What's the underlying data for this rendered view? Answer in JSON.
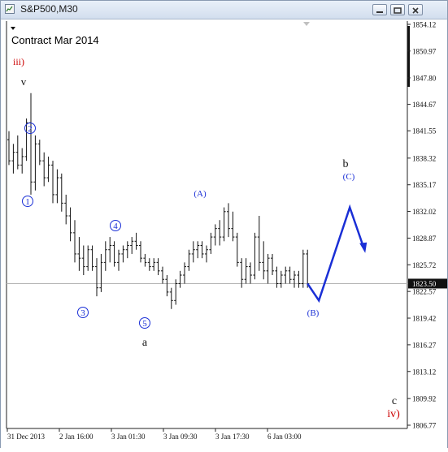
{
  "window": {
    "title": "S&P500,M30"
  },
  "contract_label": "Contract Mar 2014",
  "colors": {
    "bar": "#111111",
    "wave_blue": "#1a2fd6",
    "wave_red": "#cc0000",
    "wave_black": "#111111",
    "price_line": "#b5b5b5",
    "price_tag_bg": "#111111"
  },
  "chart_data": {
    "type": "ohlc",
    "price_axis_ticks": [
      "1854.12",
      "1850.97",
      "1847.80",
      "1844.67",
      "1841.55",
      "1838.32",
      "1835.17",
      "1832.02",
      "1828.87",
      "1825.72",
      "1822.57",
      "1819.42",
      "1816.27",
      "1813.12",
      "1809.92",
      "1806.77"
    ],
    "time_axis_labels": [
      "31 Dec 2013",
      "2 Jan 16:00",
      "3 Jan 01:30",
      "3 Jan 09:30",
      "3 Jan 17:30",
      "6 Jan 03:00"
    ],
    "current_price": "1823.50",
    "ylim": [
      1806.77,
      1854.12
    ],
    "bars": [
      [
        1840.5,
        1841.5,
        1837.5,
        1838.0
      ],
      [
        1838.0,
        1840.0,
        1836.5,
        1839.0
      ],
      [
        1839.0,
        1841.0,
        1837.0,
        1837.5
      ],
      [
        1837.5,
        1839.5,
        1836.5,
        1838.5
      ],
      [
        1838.5,
        1843.0,
        1838.0,
        1842.5
      ],
      [
        1842.5,
        1846.0,
        1834.0,
        1835.5
      ],
      [
        1835.5,
        1841.0,
        1834.5,
        1840.0
      ],
      [
        1840.0,
        1840.5,
        1837.5,
        1838.0
      ],
      [
        1838.0,
        1839.0,
        1835.0,
        1836.0
      ],
      [
        1836.0,
        1838.5,
        1835.5,
        1837.5
      ],
      [
        1837.5,
        1838.0,
        1833.0,
        1834.0
      ],
      [
        1834.0,
        1837.0,
        1833.0,
        1836.0
      ],
      [
        1836.0,
        1836.5,
        1832.0,
        1833.0
      ],
      [
        1833.0,
        1834.0,
        1830.5,
        1831.5
      ],
      [
        1831.5,
        1832.5,
        1828.5,
        1829.5
      ],
      [
        1829.5,
        1831.0,
        1826.0,
        1827.0
      ],
      [
        1827.0,
        1829.0,
        1825.0,
        1826.5
      ],
      [
        1826.5,
        1828.0,
        1824.5,
        1825.5
      ],
      [
        1825.5,
        1828.0,
        1825.0,
        1827.5
      ],
      [
        1827.5,
        1828.0,
        1825.0,
        1825.5
      ],
      [
        1825.5,
        1826.5,
        1822.0,
        1823.0
      ],
      [
        1823.0,
        1827.0,
        1822.5,
        1826.0
      ],
      [
        1826.0,
        1828.5,
        1825.0,
        1827.5
      ],
      [
        1827.5,
        1829.0,
        1826.0,
        1828.0
      ],
      [
        1828.0,
        1828.5,
        1825.5,
        1826.0
      ],
      [
        1826.0,
        1827.5,
        1825.0,
        1827.0
      ],
      [
        1827.0,
        1828.0,
        1826.0,
        1827.5
      ],
      [
        1827.5,
        1828.5,
        1826.5,
        1828.0
      ],
      [
        1828.0,
        1829.0,
        1827.0,
        1828.5
      ],
      [
        1828.5,
        1829.5,
        1827.5,
        1828.0
      ],
      [
        1828.0,
        1828.5,
        1826.0,
        1826.5
      ],
      [
        1826.5,
        1827.0,
        1825.5,
        1826.0
      ],
      [
        1826.0,
        1826.5,
        1825.0,
        1825.5
      ],
      [
        1825.5,
        1826.5,
        1825.0,
        1826.0
      ],
      [
        1826.0,
        1826.5,
        1824.5,
        1825.0
      ],
      [
        1825.0,
        1825.5,
        1823.5,
        1824.0
      ],
      [
        1824.0,
        1824.5,
        1822.0,
        1822.5
      ],
      [
        1822.5,
        1823.0,
        1820.5,
        1821.5
      ],
      [
        1821.5,
        1824.0,
        1821.0,
        1823.5
      ],
      [
        1823.5,
        1825.0,
        1823.0,
        1824.5
      ],
      [
        1824.5,
        1826.0,
        1823.5,
        1825.5
      ],
      [
        1825.5,
        1827.5,
        1825.0,
        1827.0
      ],
      [
        1827.0,
        1828.5,
        1826.0,
        1827.5
      ],
      [
        1827.5,
        1828.5,
        1826.5,
        1828.0
      ],
      [
        1828.0,
        1828.5,
        1826.5,
        1827.0
      ],
      [
        1827.0,
        1828.0,
        1826.0,
        1827.5
      ],
      [
        1827.5,
        1829.5,
        1827.0,
        1829.0
      ],
      [
        1829.0,
        1830.5,
        1828.0,
        1830.0
      ],
      [
        1830.0,
        1831.0,
        1828.0,
        1829.0
      ],
      [
        1829.0,
        1832.5,
        1828.5,
        1832.0
      ],
      [
        1832.0,
        1833.0,
        1829.0,
        1830.0
      ],
      [
        1830.0,
        1832.0,
        1828.5,
        1829.0
      ],
      [
        1829.0,
        1829.5,
        1825.5,
        1826.0
      ],
      [
        1826.0,
        1826.5,
        1823.0,
        1824.0
      ],
      [
        1824.0,
        1826.5,
        1823.5,
        1825.5
      ],
      [
        1825.5,
        1826.0,
        1823.5,
        1824.5
      ],
      [
        1824.5,
        1829.5,
        1824.0,
        1829.0
      ],
      [
        1829.0,
        1831.5,
        1825.0,
        1826.0
      ],
      [
        1826.0,
        1828.5,
        1824.0,
        1825.0
      ],
      [
        1825.0,
        1827.0,
        1823.5,
        1826.5
      ],
      [
        1826.5,
        1827.0,
        1824.5,
        1825.0
      ],
      [
        1825.0,
        1825.5,
        1823.0,
        1823.5
      ],
      [
        1823.5,
        1825.0,
        1823.0,
        1824.5
      ],
      [
        1824.5,
        1825.5,
        1823.5,
        1825.0
      ],
      [
        1825.0,
        1825.5,
        1823.5,
        1824.0
      ],
      [
        1824.0,
        1825.0,
        1823.0,
        1824.5
      ],
      [
        1824.5,
        1825.0,
        1823.0,
        1823.5
      ],
      [
        1823.5,
        1827.5,
        1823.0,
        1827.0
      ],
      [
        1827.0,
        1827.5,
        1823.0,
        1823.5
      ]
    ],
    "projection": [
      [
        1823.5,
        1821.5
      ],
      [
        1821.5,
        1832.5
      ],
      [
        1832.5,
        1827.5
      ]
    ],
    "wave_labels": [
      {
        "text": "iii)",
        "color": "wave_red",
        "style": "plain"
      },
      {
        "text": "v",
        "color": "wave_black",
        "style": "plain"
      },
      {
        "text": "2",
        "color": "wave_blue",
        "style": "circle"
      },
      {
        "text": "1",
        "color": "wave_blue",
        "style": "circle"
      },
      {
        "text": "3",
        "color": "wave_blue",
        "style": "circle"
      },
      {
        "text": "4",
        "color": "wave_blue",
        "style": "circle"
      },
      {
        "text": "5",
        "color": "wave_blue",
        "style": "circle"
      },
      {
        "text": "a",
        "color": "wave_black",
        "style": "plain"
      },
      {
        "text": "(A)",
        "color": "wave_blue",
        "style": "plain"
      },
      {
        "text": "(B)",
        "color": "wave_blue",
        "style": "plain"
      },
      {
        "text": "b",
        "color": "wave_black",
        "style": "plain"
      },
      {
        "text": "(C)",
        "color": "wave_blue",
        "style": "plain"
      },
      {
        "text": "c",
        "color": "wave_black",
        "style": "plain"
      },
      {
        "text": "iv)",
        "color": "wave_red",
        "style": "plain"
      }
    ]
  }
}
